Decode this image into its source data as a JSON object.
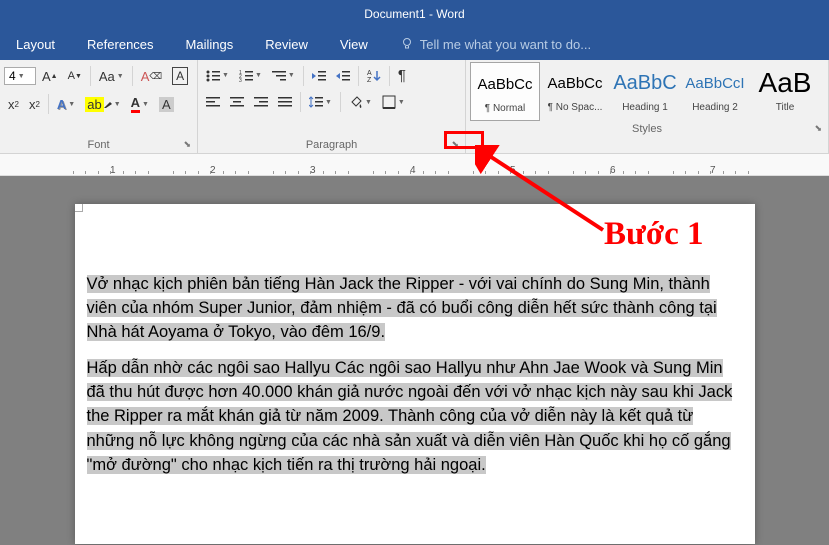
{
  "title": "Document1 - Word",
  "tabs": {
    "layout": "Layout",
    "references": "References",
    "mailings": "Mailings",
    "review": "Review",
    "view": "View"
  },
  "tell_me": "Tell me what you want to do...",
  "font_size": "4",
  "groups": {
    "font": "Font",
    "paragraph": "Paragraph",
    "styles": "Styles"
  },
  "styles": [
    {
      "preview": "AaBbCc",
      "name": "¶ Normal",
      "color": "#000",
      "weight": "normal"
    },
    {
      "preview": "AaBbCc",
      "name": "¶ No Spac...",
      "color": "#000",
      "weight": "normal"
    },
    {
      "preview": "AaBbC",
      "name": "Heading 1",
      "color": "#2e74b5",
      "weight": "normal"
    },
    {
      "preview": "AaBbCcI",
      "name": "Heading 2",
      "color": "#2e74b5",
      "weight": "normal"
    },
    {
      "preview": "AaB",
      "name": "Title",
      "color": "#000",
      "weight": "normal"
    }
  ],
  "ruler_ticks": [
    "1",
    "2",
    "3",
    "4",
    "5",
    "6",
    "7"
  ],
  "document": {
    "p1": "Vở nhạc kịch phiên bản tiếng Hàn Jack the Ripper - với vai chính do Sung Min, thành viên của nhóm Super Junior, đảm nhiệm - đã có buổi công diễn hết sức thành công tại Nhà hát Aoyama ở Tokyo, vào đêm 16/9.",
    "p2": "Hấp dẫn nhờ các ngôi sao Hallyu Các ngôi sao Hallyu như Ahn Jae Wook và Sung Min đã thu hút được hơn 40.000 khán giả nước ngoài đến với vở nhạc kịch này sau khi Jack the Ripper ra mắt khán giả từ năm 2009. Thành công của vở diễn này là kết quả từ những nỗ lực không ngừng của các nhà sản xuất và diễn viên Hàn Quốc khi họ cố gắng \"mở đường\" cho nhạc kịch tiến ra thị trường hải ngoại."
  },
  "annotation": "Bước 1"
}
